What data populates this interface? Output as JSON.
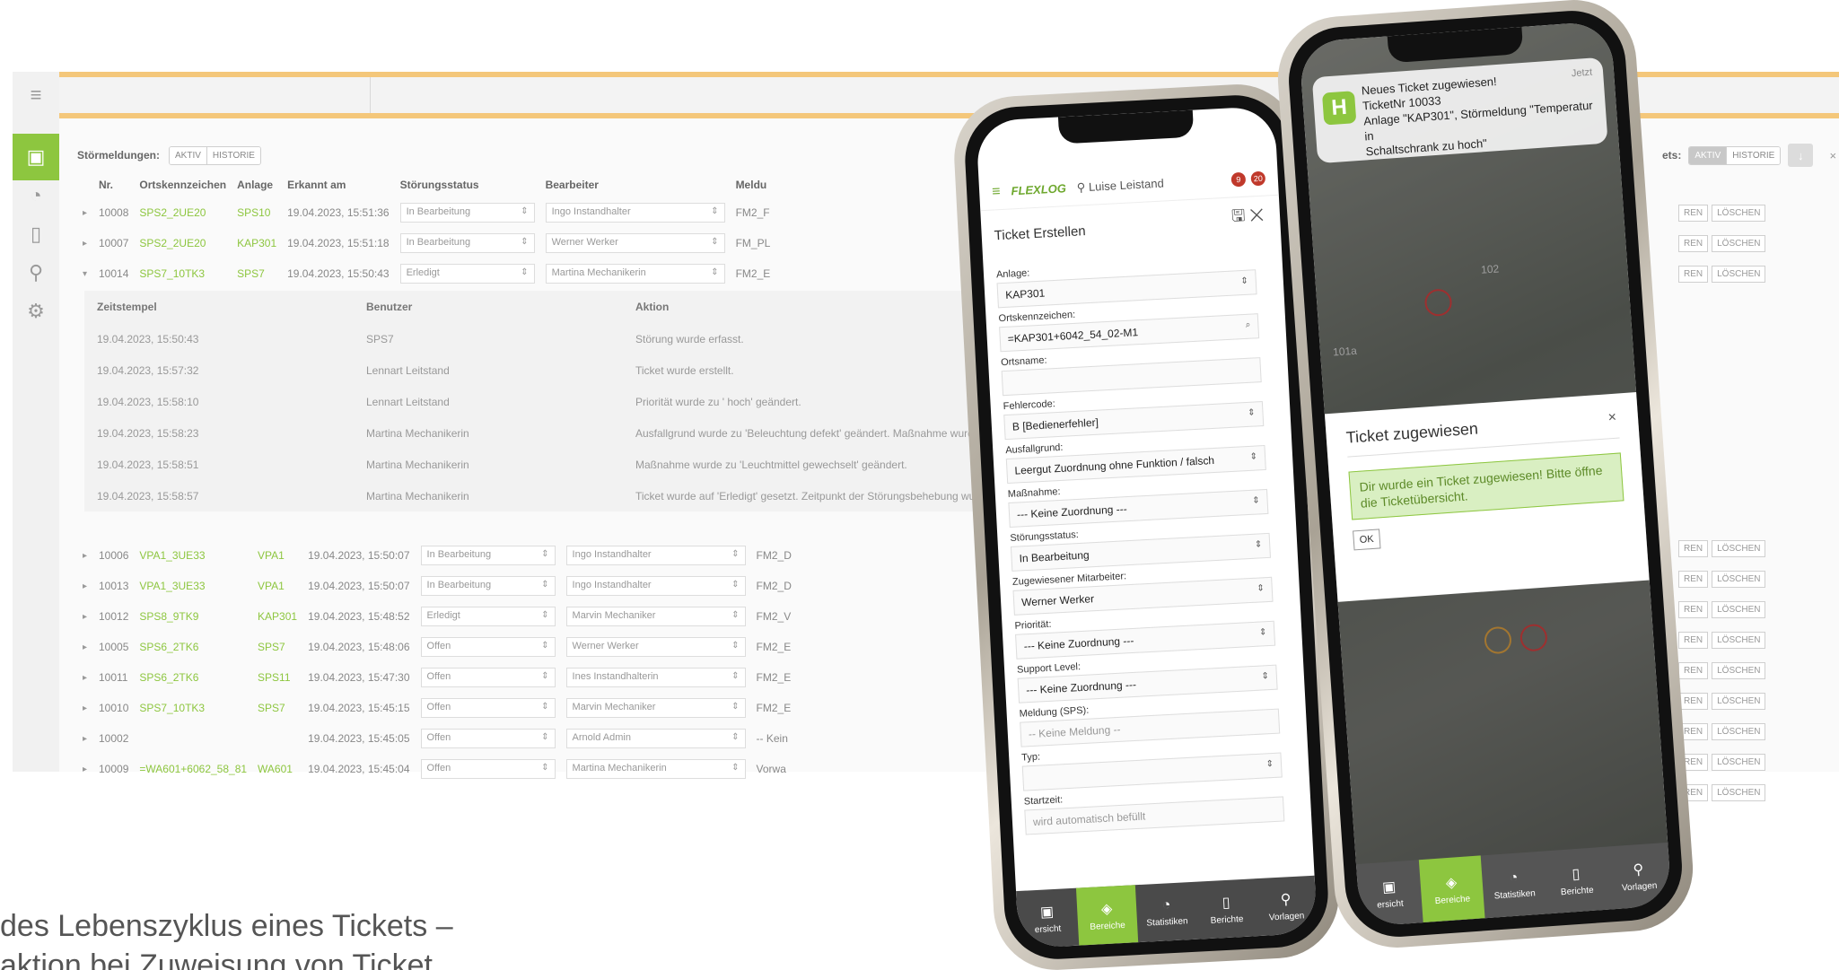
{
  "desktop": {
    "sidebar": [
      {
        "icon": "menu-icon",
        "glyph": "≡"
      },
      {
        "icon": "image-icon",
        "glyph": "▣"
      },
      {
        "icon": "chart-icon",
        "glyph": "◔"
      },
      {
        "icon": "document-icon",
        "glyph": "▯"
      },
      {
        "icon": "user-icon",
        "glyph": "⚲"
      },
      {
        "icon": "settings-icon",
        "glyph": "⚙"
      }
    ],
    "filter_label": "Störmeldungen:",
    "filter_tabs": [
      "AKTIV",
      "HISTORIE"
    ],
    "right_filter_label": "ets:",
    "right_filter_tabs": [
      "AKTIV",
      "HISTORIE"
    ],
    "right_tools": [
      "↓",
      "×"
    ],
    "columns": [
      "Nr.",
      "Ortskennzeichen",
      "Anlage",
      "Erkannt am",
      "Störungsstatus",
      "Bearbeiter",
      "Meldu"
    ],
    "rows_top": [
      {
        "nr": "10008",
        "ort": "SPS2_2UE20",
        "anlage": "SPS10",
        "erkannt": "19.04.2023, 15:51:36",
        "status": "In Bearbeitung",
        "bearbeiter": "Ingo Instandhalter",
        "meld": "FM2_F",
        "expanded": false
      },
      {
        "nr": "10007",
        "ort": "SPS2_2UE20",
        "anlage": "KAP301",
        "erkannt": "19.04.2023, 15:51:18",
        "status": "In Bearbeitung",
        "bearbeiter": "Werner Werker",
        "meld": "FM_PL",
        "expanded": false
      },
      {
        "nr": "10014",
        "ort": "SPS7_10TK3",
        "anlage": "SPS7",
        "erkannt": "19.04.2023, 15:50:43",
        "status": "Erledigt",
        "bearbeiter": "Martina Mechanikerin",
        "meld": "FM2_E",
        "expanded": true
      }
    ],
    "log_columns": [
      "Zeitstempel",
      "Benutzer",
      "Aktion"
    ],
    "log_rows": [
      {
        "ts": "19.04.2023, 15:50:43",
        "user": "SPS7",
        "action": "Störung wurde erfasst."
      },
      {
        "ts": "19.04.2023, 15:57:32",
        "user": "Lennart Leitstand",
        "action": "Ticket wurde erstellt."
      },
      {
        "ts": "19.04.2023, 15:58:10",
        "user": "Lennart Leitstand",
        "action": "Priorität wurde zu ' hoch' geändert."
      },
      {
        "ts": "19.04.2023, 15:58:23",
        "user": "Martina Mechanikerin",
        "action": "Ausfallgrund wurde zu 'Beleuchtung defekt' geändert. Maßnahme wurd"
      },
      {
        "ts": "19.04.2023, 15:58:51",
        "user": "Martina Mechanikerin",
        "action": "Maßnahme wurde zu 'Leuchtmittel gewechselt' geändert."
      },
      {
        "ts": "19.04.2023, 15:58:57",
        "user": "Martina Mechanikerin",
        "action": "Ticket wurde auf 'Erledigt' gesetzt. Zeitpunkt der Störungsbehebung wu"
      }
    ],
    "rows_bottom": [
      {
        "nr": "10006",
        "ort": "VPA1_3UE33",
        "anlage": "VPA1",
        "erkannt": "19.04.2023, 15:50:07",
        "status": "In Bearbeitung",
        "bearbeiter": "Ingo Instandhalter",
        "meld": "FM2_D"
      },
      {
        "nr": "10013",
        "ort": "VPA1_3UE33",
        "anlage": "VPA1",
        "erkannt": "19.04.2023, 15:50:07",
        "status": "In Bearbeitung",
        "bearbeiter": "Ingo Instandhalter",
        "meld": "FM2_D"
      },
      {
        "nr": "10012",
        "ort": "SPS8_9TK9",
        "anlage": "KAP301",
        "erkannt": "19.04.2023, 15:48:52",
        "status": "Erledigt",
        "bearbeiter": "Marvin Mechaniker",
        "meld": "FM2_V"
      },
      {
        "nr": "10005",
        "ort": "SPS6_2TK6",
        "anlage": "SPS7",
        "erkannt": "19.04.2023, 15:48:06",
        "status": "Offen",
        "bearbeiter": "Werner Werker",
        "meld": "FM2_E"
      },
      {
        "nr": "10011",
        "ort": "SPS6_2TK6",
        "anlage": "SPS11",
        "erkannt": "19.04.2023, 15:47:30",
        "status": "Offen",
        "bearbeiter": "Ines Instandhalterin",
        "meld": "FM2_E"
      },
      {
        "nr": "10010",
        "ort": "SPS7_10TK3",
        "anlage": "SPS7",
        "erkannt": "19.04.2023, 15:45:15",
        "status": "Offen",
        "bearbeiter": "Marvin Mechaniker",
        "meld": "FM2_E"
      },
      {
        "nr": "10002",
        "ort": "",
        "anlage": "",
        "erkannt": "19.04.2023, 15:45:05",
        "status": "Offen",
        "bearbeiter": "Arnold Admin",
        "meld": "-- Kein"
      },
      {
        "nr": "10009",
        "ort": "=WA601+6062_58_81",
        "anlage": "WA601",
        "erkannt": "19.04.2023, 15:45:04",
        "status": "Offen",
        "bearbeiter": "Martina Mechanikerin",
        "meld": "Vorwa"
      }
    ],
    "row_buttons": [
      "REN",
      "LÖSCHEN"
    ]
  },
  "caption": {
    "line1": "des Lebenszyklus eines Tickets –",
    "line2": "aktion   bei Zuweisung von Ticket"
  },
  "phone1": {
    "logo": "FLEXLOG",
    "user": "Luise Leistand",
    "badges": [
      "9",
      "20"
    ],
    "title": "Ticket Erstellen",
    "fields": [
      {
        "label": "Anlage:",
        "value": "KAP301",
        "select": true,
        "placeholder": false
      },
      {
        "label": "Ortskennzeichen:",
        "value": "=KAP301+6042_54_02-M1",
        "select": false,
        "placeholder": false
      },
      {
        "label": "Ortsname:",
        "value": "",
        "select": false,
        "placeholder": false
      },
      {
        "label": "Fehlercode:",
        "value": "B [Bedienerfehler]",
        "select": true,
        "placeholder": false
      },
      {
        "label": "Ausfallgrund:",
        "value": "Leergut Zuordnung ohne Funktion / falsch",
        "select": true,
        "placeholder": false
      },
      {
        "label": "Maßnahme:",
        "value": "--- Keine Zuordnung ---",
        "select": true,
        "placeholder": false
      },
      {
        "label": "Störungsstatus:",
        "value": "In Bearbeitung",
        "select": true,
        "placeholder": false
      },
      {
        "label": "Zugewiesener Mitarbeiter:",
        "value": "Werner Werker",
        "select": true,
        "placeholder": false
      },
      {
        "label": "Priorität:",
        "value": "--- Keine Zuordnung ---",
        "select": true,
        "placeholder": false
      },
      {
        "label": "Support Level:",
        "value": "--- Keine Zuordnung ---",
        "select": true,
        "placeholder": false
      },
      {
        "label": "Meldung (SPS):",
        "value": "-- Keine Meldung --",
        "select": false,
        "placeholder": true
      },
      {
        "label": "Typ:",
        "value": "",
        "select": true,
        "placeholder": false
      },
      {
        "label": "Startzeit:",
        "value": "wird automatisch befüllt",
        "select": false,
        "placeholder": true
      }
    ],
    "nav": [
      {
        "label": "ersicht",
        "icon": "image-icon",
        "glyph": "▣",
        "active": false
      },
      {
        "label": "Bereiche",
        "icon": "layers-icon",
        "glyph": "◈",
        "active": true
      },
      {
        "label": "Statistiken",
        "icon": "chart-icon",
        "glyph": "◔",
        "active": false
      },
      {
        "label": "Berichte",
        "icon": "document-icon",
        "glyph": "▯",
        "active": false
      },
      {
        "label": "Vorlagen",
        "icon": "user-icon",
        "glyph": "⚲",
        "active": false
      }
    ]
  },
  "phone2": {
    "notification": {
      "title": "Neues Ticket zugewiesen!",
      "time": "Jetzt",
      "line2": "TicketNr 10033",
      "line3": "Anlage \"KAP301\", Störmeldung \"Temperatur in",
      "line4": "Schaltschrank zu hoch\"",
      "app_letter": "H"
    },
    "map_labels": {
      "a": "102",
      "b": "101a"
    },
    "modal": {
      "title": "Ticket zugewiesen",
      "close": "×",
      "message": "Dir wurde ein Ticket zugewiesen! Bitte öffne die Ticketübersicht.",
      "ok": "OK"
    },
    "nav": [
      {
        "label": "ersicht",
        "icon": "image-icon",
        "glyph": "▣",
        "active": false
      },
      {
        "label": "Bereiche",
        "icon": "layers-icon",
        "glyph": "◈",
        "active": true
      },
      {
        "label": "Statistiken",
        "icon": "chart-icon",
        "glyph": "◔",
        "active": false
      },
      {
        "label": "Berichte",
        "icon": "document-icon",
        "glyph": "▯",
        "active": false
      },
      {
        "label": "Vorlagen",
        "icon": "user-icon",
        "glyph": "⚲",
        "active": false
      }
    ]
  },
  "colors": {
    "accent": "#8dc63f",
    "accent_text": "#6ea82e",
    "alert_red": "#c0392b",
    "stripe": "#f4c77a"
  }
}
